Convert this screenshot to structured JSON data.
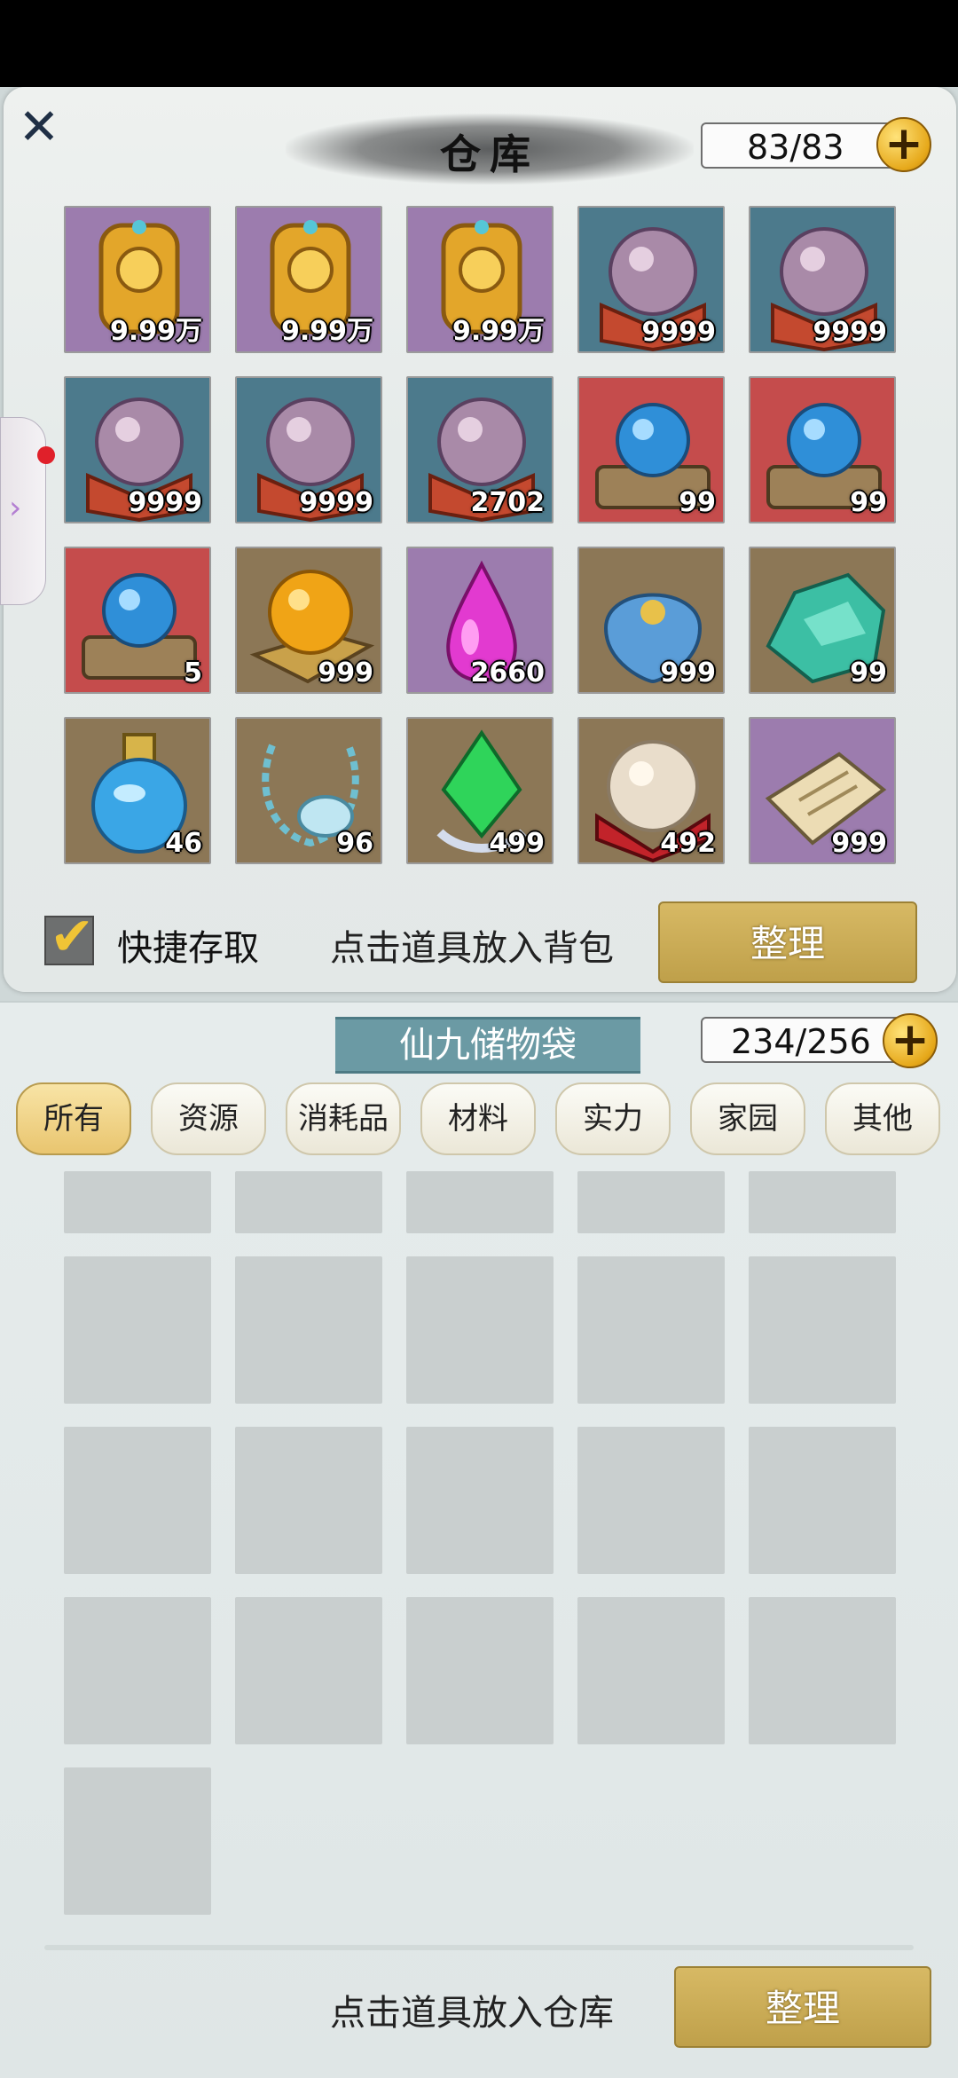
{
  "warehouse": {
    "title": "仓库",
    "capacity": "83/83",
    "quick_access_label": "快捷存取",
    "quick_access_checked": true,
    "hint": "点击道具放入背包",
    "sort_label": "整理",
    "items": [
      {
        "qty": "9.99万",
        "bg": "purple",
        "icon": "golden-token-icon"
      },
      {
        "qty": "9.99万",
        "bg": "purple",
        "icon": "golden-token-icon"
      },
      {
        "qty": "9.99万",
        "bg": "purple",
        "icon": "golden-token-icon"
      },
      {
        "qty": "9999",
        "bg": "teal",
        "icon": "purple-crystal-orb-icon"
      },
      {
        "qty": "9999",
        "bg": "teal",
        "icon": "purple-crystal-orb-icon"
      },
      {
        "qty": "9999",
        "bg": "teal",
        "icon": "purple-crystal-orb-icon"
      },
      {
        "qty": "9999",
        "bg": "teal",
        "icon": "purple-crystal-orb-icon"
      },
      {
        "qty": "2702",
        "bg": "teal",
        "icon": "purple-crystal-orb-icon"
      },
      {
        "qty": "99",
        "bg": "red",
        "icon": "blue-orb-on-stand-icon"
      },
      {
        "qty": "99",
        "bg": "red",
        "icon": "blue-orb-on-stand-icon"
      },
      {
        "qty": "5",
        "bg": "red",
        "icon": "blue-orb-on-stand-icon"
      },
      {
        "qty": "999",
        "bg": "brown",
        "icon": "golden-ball-on-cloth-icon"
      },
      {
        "qty": "2660",
        "bg": "purple",
        "icon": "pink-gem-drop-icon"
      },
      {
        "qty": "999",
        "bg": "brown",
        "icon": "blue-lotus-leaf-icon"
      },
      {
        "qty": "99",
        "bg": "brown",
        "icon": "jade-stone-icon"
      },
      {
        "qty": "46",
        "bg": "brown",
        "icon": "blue-potion-bottle-icon"
      },
      {
        "qty": "96",
        "bg": "brown",
        "icon": "jade-pendant-necklace-icon"
      },
      {
        "qty": "499",
        "bg": "brown",
        "icon": "green-crystal-icon"
      },
      {
        "qty": "492",
        "bg": "brown",
        "icon": "pearl-in-box-icon"
      },
      {
        "qty": "999",
        "bg": "purple",
        "icon": "scroll-book-icon"
      }
    ]
  },
  "bag": {
    "title": "仙九储物袋",
    "capacity": "234/256",
    "tabs": [
      "所有",
      "资源",
      "消耗品",
      "材料",
      "实力",
      "家园",
      "其他"
    ],
    "active_tab": 0,
    "hint": "点击道具放入仓库",
    "sort_label": "整理",
    "empty_slots": 21
  },
  "colors": {
    "purple": "#9c7cae",
    "teal": "#4c7a8c",
    "red": "#c54c4c",
    "brown": "#8c7756",
    "gold": "#d7b964"
  }
}
